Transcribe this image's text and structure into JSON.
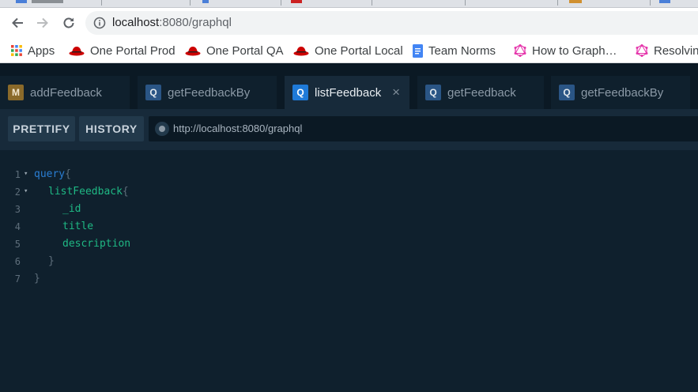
{
  "browser": {
    "url_host": "localhost",
    "url_path": ":8080/graphql"
  },
  "bookmarks": [
    {
      "label": "Apps",
      "icon": "apps-grid-icon"
    },
    {
      "label": "One Portal Prod",
      "icon": "redhat-icon"
    },
    {
      "label": "One Portal QA",
      "icon": "redhat-icon"
    },
    {
      "label": "One Portal Local",
      "icon": "redhat-icon"
    },
    {
      "label": "Team Norms",
      "icon": "google-docs-icon"
    },
    {
      "label": "How to Graph…",
      "icon": "graphql-icon"
    },
    {
      "label": "Resolvin",
      "icon": "graphql-icon"
    }
  ],
  "playground": {
    "tabs": [
      {
        "badge": "M",
        "label": "addFeedback",
        "active": false
      },
      {
        "badge": "Q",
        "label": "getFeedbackBy",
        "active": false
      },
      {
        "badge": "Q",
        "label": "listFeedback",
        "active": true,
        "close": "×"
      },
      {
        "badge": "Q",
        "label": "getFeedback",
        "active": false
      },
      {
        "badge": "Q",
        "label": "getFeedbackBy",
        "active": false
      }
    ],
    "prettify_label": "PRETTIFY",
    "history_label": "HISTORY",
    "endpoint": "http://localhost:8080/graphql"
  },
  "editor": {
    "lines": [
      {
        "num": "1",
        "fold": "▾",
        "tokens": [
          {
            "text": "query",
            "kind": "keyword"
          },
          {
            "text": "{",
            "kind": "brace"
          }
        ]
      },
      {
        "num": "2",
        "fold": "▾",
        "tokens": [
          {
            "text": "listFeedback",
            "kind": "field"
          },
          {
            "text": "{",
            "kind": "brace"
          }
        ]
      },
      {
        "num": "3",
        "fold": "",
        "tokens": [
          {
            "text": "_id",
            "kind": "field"
          }
        ]
      },
      {
        "num": "4",
        "fold": "",
        "tokens": [
          {
            "text": "title",
            "kind": "field"
          }
        ]
      },
      {
        "num": "5",
        "fold": "",
        "tokens": [
          {
            "text": "description",
            "kind": "field"
          }
        ]
      },
      {
        "num": "6",
        "fold": "",
        "tokens": [
          {
            "text": "}",
            "kind": "brace"
          }
        ]
      },
      {
        "num": "7",
        "fold": "",
        "tokens": [
          {
            "text": "}",
            "kind": "brace"
          }
        ]
      }
    ]
  },
  "colors": {
    "background": "#0f202d",
    "keyword": "#2a7ed3",
    "field": "#1fb884",
    "active_badge": "#1f7ad8"
  }
}
